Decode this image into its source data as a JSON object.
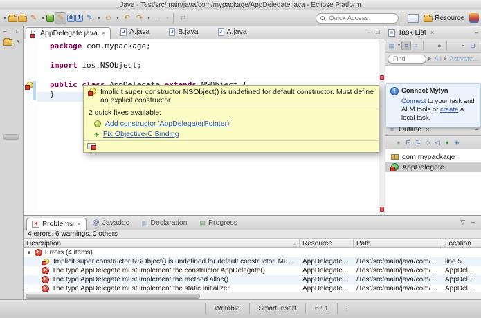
{
  "colors": {
    "keyword": "#7b0052",
    "link": "#2b50c5",
    "error": "#d33b30",
    "tooltip_bg": "#fbfcc3",
    "mylyn_bg": "#eaf3fc",
    "row_stripe": "#edf4fb",
    "current_line": "#e9f2fb"
  },
  "window": {
    "title": "Java - Test/src/main/java/com/mypackage/AppDelegate.java - Eclipse Platform"
  },
  "toolbar": {
    "quick_access_placeholder": "Quick Access",
    "perspective_resource": "Resource",
    "icons": [
      {
        "name": "new-wizard-chevron",
        "g": "▾",
        "c": "#555",
        "small": true
      },
      {
        "name": "import",
        "k": "folder"
      },
      {
        "name": "export",
        "k": "folder"
      },
      {
        "name": "external-tools",
        "g": "✎",
        "c": "#c08a2d"
      },
      {
        "name": "external-tools-chevron",
        "g": "▾",
        "c": "#555",
        "small": true
      },
      {
        "name": "debug",
        "k": "grn"
      },
      {
        "name": "highlight-tool",
        "g": "✎",
        "c": "#caa23a",
        "pressed": true
      },
      {
        "name": "java-launch-0",
        "k": "blu",
        "g": "0"
      },
      {
        "name": "java-launch-1",
        "k": "blu",
        "g": "1"
      },
      {
        "name": "new-java-element",
        "g": "✎",
        "c": "#4a6fb0"
      },
      {
        "name": "new-java-element-chevron",
        "g": "▾",
        "c": "#555",
        "small": true
      },
      {
        "name": "open-task",
        "g": "☺",
        "c": "#b5893a"
      },
      {
        "name": "open-task-chevron",
        "g": "▾",
        "c": "#555",
        "small": true
      },
      {
        "name": "back-navigation",
        "g": "↶",
        "c": "#c89a30"
      },
      {
        "name": "forward-navigation",
        "g": "↷",
        "c": "#c89a30"
      },
      {
        "name": "forward-navigation-chevron",
        "g": "▾",
        "c": "#555",
        "small": true
      },
      {
        "name": "forward-history",
        "g": "→",
        "c": "#a0a0a0"
      },
      {
        "name": "forward-history-chevron",
        "g": "▾",
        "c": "#bbb",
        "small": true
      },
      {
        "sep": true
      },
      {
        "name": "link-with-editor",
        "g": "⇄",
        "c": "#999"
      }
    ]
  },
  "editor": {
    "tabs": [
      "AppDelegate.java",
      "A.java",
      "B.java",
      "A.java"
    ],
    "code": {
      "l1_kw": "package",
      "l1_rest": " com.mypackage;",
      "l3_kw": "import",
      "l3_rest": " ios.NSObject;",
      "l5_kw1": "public class ",
      "l5_err": "AppDelegate",
      "l5_kw2": " extends ",
      "l5_rest": "NSObject {",
      "l6": "}"
    },
    "tooltip": {
      "message": "Implicit super constructor NSObject() is undefined for default constructor. Must define an explicit constructor",
      "fixes_label": "2 quick fixes available:",
      "fix1": "Add constructor 'AppDelegate(Pointer)'",
      "fix2": "Fix Objective-C Binding"
    }
  },
  "task_list": {
    "title": "Task List",
    "find_placeholder": "Find",
    "link_all": "All",
    "link_activate": "Activate...",
    "icons": [
      {
        "name": "new-task",
        "g": "▤",
        "c": "#5b7fb5"
      },
      {
        "name": "new-task-chevron",
        "g": "▾",
        "c": "#555",
        "small": true
      },
      {
        "name": "categorized-presentation",
        "g": "≡",
        "c": "#4a6fb0",
        "pressed": true
      },
      {
        "name": "scheduled-presentation",
        "g": "≡",
        "c": "#90a8c8"
      },
      {
        "sep": true
      },
      {
        "name": "focus-on-workweek",
        "g": "●",
        "c": "#777"
      },
      {
        "sep": true
      },
      {
        "name": "filter-completed",
        "g": "×",
        "c": "#555"
      },
      {
        "name": "collapse-all",
        "g": "⊟",
        "c": "#4a6fb0"
      },
      {
        "sep": true
      },
      {
        "name": "synchronize",
        "g": "↻",
        "c": "#caa23a"
      }
    ],
    "mylyn": {
      "title": "Connect Mylyn",
      "link_connect": "Connect",
      "text_mid": " to your task and ALM tools or ",
      "link_create": "create",
      "text_end": " a local task."
    }
  },
  "outline": {
    "title": "Outline",
    "icons": [
      {
        "name": "focus",
        "g": "●",
        "c": "#999"
      },
      {
        "name": "collapse-all",
        "g": "⊟",
        "c": "#4a6fb0"
      },
      {
        "name": "sort",
        "g": "⇅",
        "c": "#4a6fb0"
      },
      {
        "name": "hide-fields",
        "g": "◇",
        "c": "#4a6fb0"
      },
      {
        "name": "hide-static-members",
        "g": "◁",
        "c": "#4a6fb0"
      },
      {
        "name": "hide-non-public",
        "g": "●",
        "c": "#3a9a3a"
      },
      {
        "name": "hide-local-types",
        "g": "◈",
        "c": "#4a6fb0"
      }
    ],
    "items": {
      "package": "com.mypackage",
      "class": "AppDelegate"
    }
  },
  "problems": {
    "tabs": [
      "Problems",
      "Javadoc",
      "Declaration",
      "Progress"
    ],
    "summary": "4 errors, 6 warnings, 0 others",
    "columns": [
      "Description",
      "Resource",
      "Path",
      "Location"
    ],
    "group_label": "Errors (4 items)",
    "rows": [
      {
        "description": "Implicit super constructor NSObject() is undefined for default constructor. Must define an explicit constructor",
        "resource": "AppDelegate.java",
        "path": "/Test/src/main/java/com/mypackage",
        "location": "line 5"
      },
      {
        "description": "The type AppDelegate must implement the constructor AppDelegate()",
        "resource": "AppDelegate.java",
        "path": "/Test/src/main/java/com/mypackage",
        "location": "AppDelegate"
      },
      {
        "description": "The type AppDelegate must implement the method alloc()",
        "resource": "AppDelegate.java",
        "path": "/Test/src/main/java/com/mypackage",
        "location": "AppDelegate"
      },
      {
        "description": "The type AppDelegate must implement the static initializer",
        "resource": "AppDelegate.java",
        "path": "/Test/src/main/java/com/mypackage",
        "location": "AppDelegate"
      }
    ]
  },
  "status_bar": {
    "writable": "Writable",
    "insert_mode": "Smart Insert",
    "cursor_position": "6 : 1"
  }
}
